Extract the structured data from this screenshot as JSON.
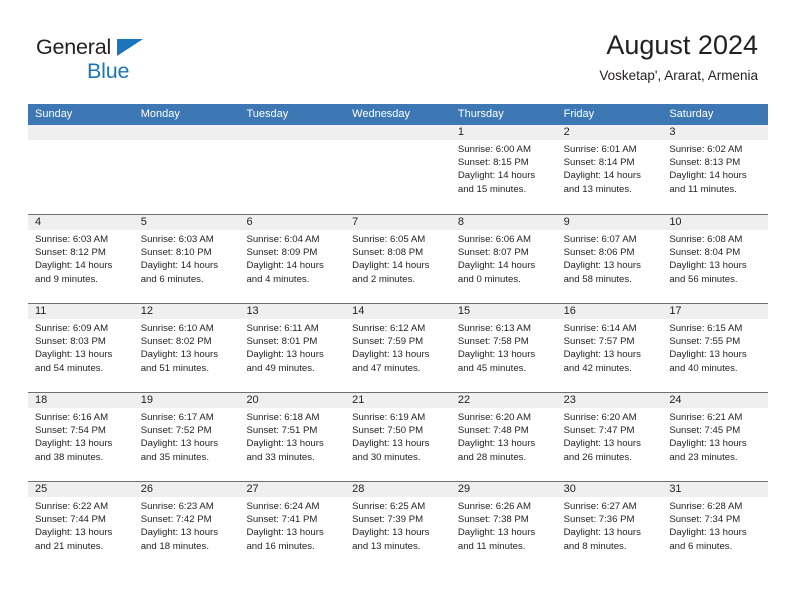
{
  "brand": {
    "name_line1": "General",
    "name_line2": "Blue",
    "flag_icon": "triangle-flag-icon",
    "accent_color": "#1b75bb"
  },
  "header": {
    "title": "August 2024",
    "subtitle": "Vosketap', Ararat, Armenia"
  },
  "theme": {
    "header_blue": "#3d78b4",
    "day_band_gray": "#efeff0",
    "row_divider": "#6f6f6f",
    "text": "#231f20"
  },
  "weekday_headers": [
    "Sunday",
    "Monday",
    "Tuesday",
    "Wednesday",
    "Thursday",
    "Friday",
    "Saturday"
  ],
  "labels": {
    "sunrise_prefix": "Sunrise:",
    "sunset_prefix": "Sunset:",
    "daylight_prefix": "Daylight:"
  },
  "weeks": [
    [
      {
        "empty": true,
        "day": "",
        "sunrise": "",
        "sunset": "",
        "daylight": ""
      },
      {
        "empty": true,
        "day": "",
        "sunrise": "",
        "sunset": "",
        "daylight": ""
      },
      {
        "empty": true,
        "day": "",
        "sunrise": "",
        "sunset": "",
        "daylight": ""
      },
      {
        "empty": true,
        "day": "",
        "sunrise": "",
        "sunset": "",
        "daylight": ""
      },
      {
        "empty": false,
        "day": "1",
        "sunrise": "Sunrise: 6:00 AM",
        "sunset": "Sunset: 8:15 PM",
        "daylight": "Daylight: 14 hours and 15 minutes."
      },
      {
        "empty": false,
        "day": "2",
        "sunrise": "Sunrise: 6:01 AM",
        "sunset": "Sunset: 8:14 PM",
        "daylight": "Daylight: 14 hours and 13 minutes."
      },
      {
        "empty": false,
        "day": "3",
        "sunrise": "Sunrise: 6:02 AM",
        "sunset": "Sunset: 8:13 PM",
        "daylight": "Daylight: 14 hours and 11 minutes."
      }
    ],
    [
      {
        "empty": false,
        "day": "4",
        "sunrise": "Sunrise: 6:03 AM",
        "sunset": "Sunset: 8:12 PM",
        "daylight": "Daylight: 14 hours and 9 minutes."
      },
      {
        "empty": false,
        "day": "5",
        "sunrise": "Sunrise: 6:03 AM",
        "sunset": "Sunset: 8:10 PM",
        "daylight": "Daylight: 14 hours and 6 minutes."
      },
      {
        "empty": false,
        "day": "6",
        "sunrise": "Sunrise: 6:04 AM",
        "sunset": "Sunset: 8:09 PM",
        "daylight": "Daylight: 14 hours and 4 minutes."
      },
      {
        "empty": false,
        "day": "7",
        "sunrise": "Sunrise: 6:05 AM",
        "sunset": "Sunset: 8:08 PM",
        "daylight": "Daylight: 14 hours and 2 minutes."
      },
      {
        "empty": false,
        "day": "8",
        "sunrise": "Sunrise: 6:06 AM",
        "sunset": "Sunset: 8:07 PM",
        "daylight": "Daylight: 14 hours and 0 minutes."
      },
      {
        "empty": false,
        "day": "9",
        "sunrise": "Sunrise: 6:07 AM",
        "sunset": "Sunset: 8:06 PM",
        "daylight": "Daylight: 13 hours and 58 minutes."
      },
      {
        "empty": false,
        "day": "10",
        "sunrise": "Sunrise: 6:08 AM",
        "sunset": "Sunset: 8:04 PM",
        "daylight": "Daylight: 13 hours and 56 minutes."
      }
    ],
    [
      {
        "empty": false,
        "day": "11",
        "sunrise": "Sunrise: 6:09 AM",
        "sunset": "Sunset: 8:03 PM",
        "daylight": "Daylight: 13 hours and 54 minutes."
      },
      {
        "empty": false,
        "day": "12",
        "sunrise": "Sunrise: 6:10 AM",
        "sunset": "Sunset: 8:02 PM",
        "daylight": "Daylight: 13 hours and 51 minutes."
      },
      {
        "empty": false,
        "day": "13",
        "sunrise": "Sunrise: 6:11 AM",
        "sunset": "Sunset: 8:01 PM",
        "daylight": "Daylight: 13 hours and 49 minutes."
      },
      {
        "empty": false,
        "day": "14",
        "sunrise": "Sunrise: 6:12 AM",
        "sunset": "Sunset: 7:59 PM",
        "daylight": "Daylight: 13 hours and 47 minutes."
      },
      {
        "empty": false,
        "day": "15",
        "sunrise": "Sunrise: 6:13 AM",
        "sunset": "Sunset: 7:58 PM",
        "daylight": "Daylight: 13 hours and 45 minutes."
      },
      {
        "empty": false,
        "day": "16",
        "sunrise": "Sunrise: 6:14 AM",
        "sunset": "Sunset: 7:57 PM",
        "daylight": "Daylight: 13 hours and 42 minutes."
      },
      {
        "empty": false,
        "day": "17",
        "sunrise": "Sunrise: 6:15 AM",
        "sunset": "Sunset: 7:55 PM",
        "daylight": "Daylight: 13 hours and 40 minutes."
      }
    ],
    [
      {
        "empty": false,
        "day": "18",
        "sunrise": "Sunrise: 6:16 AM",
        "sunset": "Sunset: 7:54 PM",
        "daylight": "Daylight: 13 hours and 38 minutes."
      },
      {
        "empty": false,
        "day": "19",
        "sunrise": "Sunrise: 6:17 AM",
        "sunset": "Sunset: 7:52 PM",
        "daylight": "Daylight: 13 hours and 35 minutes."
      },
      {
        "empty": false,
        "day": "20",
        "sunrise": "Sunrise: 6:18 AM",
        "sunset": "Sunset: 7:51 PM",
        "daylight": "Daylight: 13 hours and 33 minutes."
      },
      {
        "empty": false,
        "day": "21",
        "sunrise": "Sunrise: 6:19 AM",
        "sunset": "Sunset: 7:50 PM",
        "daylight": "Daylight: 13 hours and 30 minutes."
      },
      {
        "empty": false,
        "day": "22",
        "sunrise": "Sunrise: 6:20 AM",
        "sunset": "Sunset: 7:48 PM",
        "daylight": "Daylight: 13 hours and 28 minutes."
      },
      {
        "empty": false,
        "day": "23",
        "sunrise": "Sunrise: 6:20 AM",
        "sunset": "Sunset: 7:47 PM",
        "daylight": "Daylight: 13 hours and 26 minutes."
      },
      {
        "empty": false,
        "day": "24",
        "sunrise": "Sunrise: 6:21 AM",
        "sunset": "Sunset: 7:45 PM",
        "daylight": "Daylight: 13 hours and 23 minutes."
      }
    ],
    [
      {
        "empty": false,
        "day": "25",
        "sunrise": "Sunrise: 6:22 AM",
        "sunset": "Sunset: 7:44 PM",
        "daylight": "Daylight: 13 hours and 21 minutes."
      },
      {
        "empty": false,
        "day": "26",
        "sunrise": "Sunrise: 6:23 AM",
        "sunset": "Sunset: 7:42 PM",
        "daylight": "Daylight: 13 hours and 18 minutes."
      },
      {
        "empty": false,
        "day": "27",
        "sunrise": "Sunrise: 6:24 AM",
        "sunset": "Sunset: 7:41 PM",
        "daylight": "Daylight: 13 hours and 16 minutes."
      },
      {
        "empty": false,
        "day": "28",
        "sunrise": "Sunrise: 6:25 AM",
        "sunset": "Sunset: 7:39 PM",
        "daylight": "Daylight: 13 hours and 13 minutes."
      },
      {
        "empty": false,
        "day": "29",
        "sunrise": "Sunrise: 6:26 AM",
        "sunset": "Sunset: 7:38 PM",
        "daylight": "Daylight: 13 hours and 11 minutes."
      },
      {
        "empty": false,
        "day": "30",
        "sunrise": "Sunrise: 6:27 AM",
        "sunset": "Sunset: 7:36 PM",
        "daylight": "Daylight: 13 hours and 8 minutes."
      },
      {
        "empty": false,
        "day": "31",
        "sunrise": "Sunrise: 6:28 AM",
        "sunset": "Sunset: 7:34 PM",
        "daylight": "Daylight: 13 hours and 6 minutes."
      }
    ]
  ]
}
